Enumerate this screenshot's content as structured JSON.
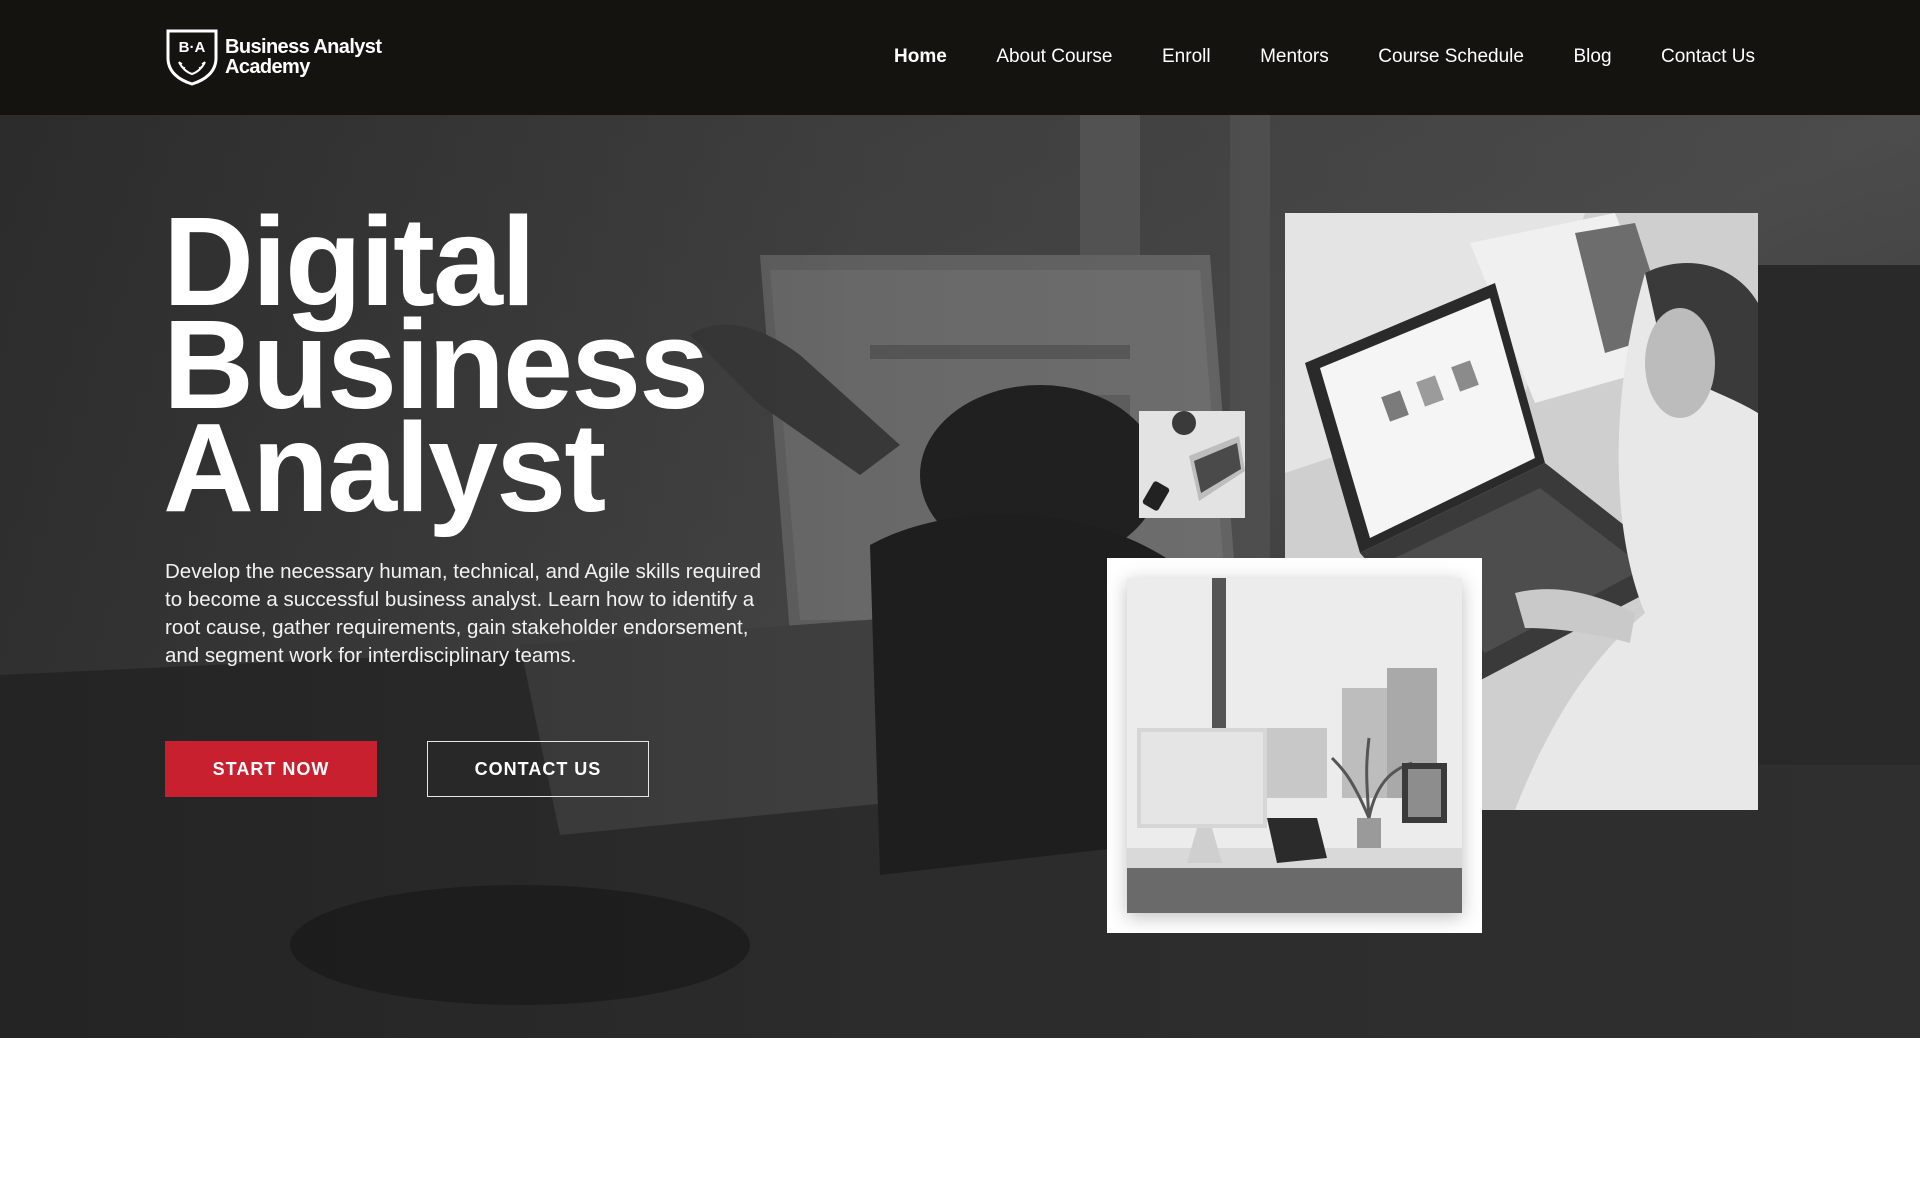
{
  "header": {
    "logo": {
      "monogram": "B·A",
      "line1": "Business Analyst",
      "line2": "Academy"
    },
    "nav": [
      {
        "label": "Home",
        "active": true
      },
      {
        "label": "About Course"
      },
      {
        "label": "Enroll"
      },
      {
        "label": "Mentors"
      },
      {
        "label": "Course Schedule"
      },
      {
        "label": "Blog"
      },
      {
        "label": "Contact Us"
      }
    ]
  },
  "hero": {
    "title_lines": [
      "Digital",
      "Business",
      "Analyst"
    ],
    "description": "Develop the necessary human, technical, and Agile skills required to become a successful business analyst. Learn how to identify a root cause, gather requirements, gain stakeholder endorsement, and segment work for interdisciplinary teams.",
    "primary_button": "START NOW",
    "secondary_button": "CONTACT US",
    "colors": {
      "accent": "#c8202f",
      "header_bg": "#15130f"
    }
  }
}
